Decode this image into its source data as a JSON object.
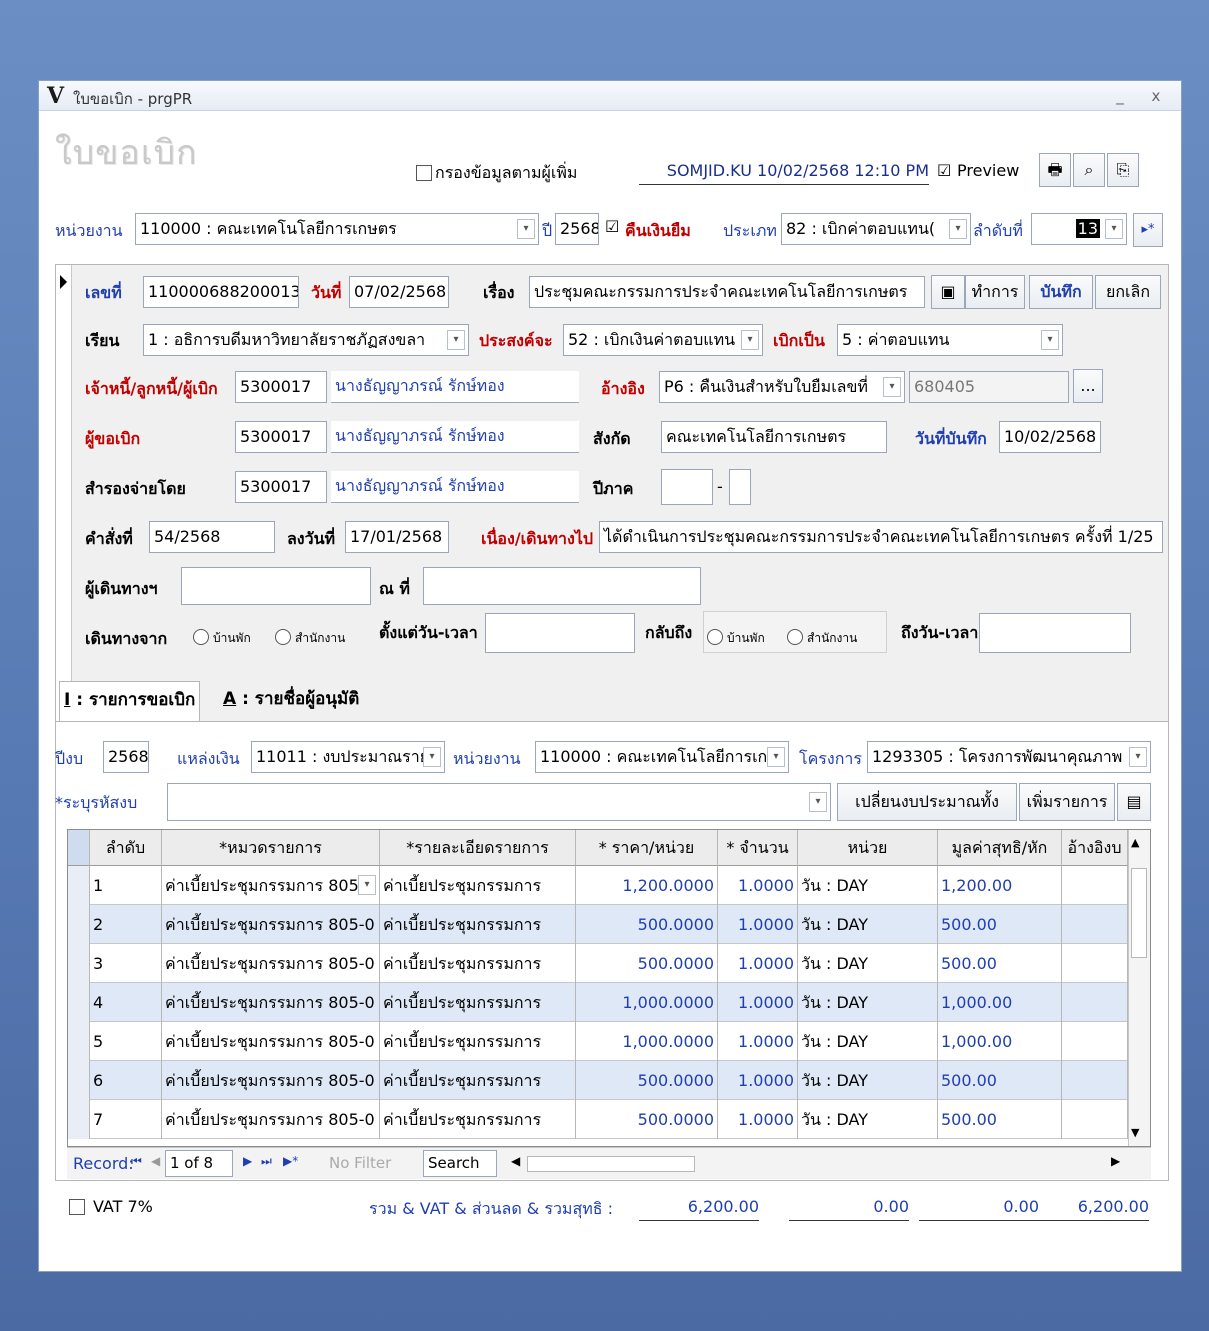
{
  "window": {
    "title": "ใบขอเบิก - prgPR",
    "logo": "V",
    "min_label": "_",
    "close_label": "x"
  },
  "header": {
    "form_title": "ใบขอเบิก",
    "filter_label": "กรองข้อมูลตามผู้เพิ่ม",
    "user_stamp": "SOMJID.KU  10/02/2568  12:10 PM",
    "preview_label": "Preview",
    "preview_checked": "☑"
  },
  "row1": {
    "unit_label": "หน่วยงาน",
    "unit_value": "110000 : คณะเทคโนโลยีการเกษตร",
    "year_label": "ปี",
    "year_value": "2568",
    "refund_label": "คืนเงินยืม",
    "refund_checked": "☑",
    "type_label": "ประเภท",
    "type_value": "82 : เบิกค่าตอบแทน(",
    "seq_label": "ลำดับที่",
    "seq_value": "13",
    "next_symbol": "▸*"
  },
  "detail": {
    "doc_no_label": "เลขที่",
    "doc_no": "110000688200013",
    "date_label": "วันที่",
    "date": "07/02/2568",
    "subject_label": "เรื่อง",
    "subject": "ประชุมคณะกรรมการประจำคณะเทคโนโลยีการเกษตร",
    "act_button": "ทำการ",
    "save_button": "บันทึก",
    "cancel_button": "ยกเลิก",
    "to_label": "เรียน",
    "to": "1 : อธิการบดีมหาวิทยาลัยราชภัฏสงขลา",
    "purpose_label": "ประสงค์จะ",
    "purpose": "52 : เบิกเงินค่าตอบแทน",
    "as_label": "เบิกเป็น",
    "as": "5 : ค่าตอบแทน",
    "creditor_label": "เจ้าหนี้/ลูกหนี้/ผู้เบิก",
    "creditor_code": "5300017",
    "creditor_name": "นางธัญญาภรณ์ รักษ์ทอง",
    "ref_label": "อ้างอิง",
    "ref_value": "P6 : คืนเงินสำหรับใบยืมเลขที่",
    "ref_no": "680405",
    "more_button": "...",
    "requester_label": "ผู้ขอเบิก",
    "requester_code": "5300017",
    "requester_name": "นางธัญญาภรณ์ รักษ์ทอง",
    "dept_label": "สังกัด",
    "dept": "คณะเทคโนโลยีการเกษตร",
    "record_date_label": "วันที่บันทึก",
    "record_date": "10/02/2568",
    "advance_label": "สำรองจ่ายโดย",
    "advance_code": "5300017",
    "advance_name": "นางธัญญาภรณ์ รักษ์ทอง",
    "term_label": "ปีภาค",
    "term_sep": "-",
    "order_label": "คำสั่งที่",
    "order_no": "54/2568",
    "order_date_label": "ลงวันที่",
    "order_date": "17/01/2568",
    "because_label": "เนื่อง/เดินทางไป",
    "because": "ได้ดำเนินการประชุมคณะกรรมการประจำคณะเทคโนโลยีการเกษตร ครั้งที่ 1/25",
    "traveler_label": "ผู้เดินทางฯ",
    "at_label": "ณ ที่",
    "from_label": "เดินทางจาก",
    "home": "บ้านพัก",
    "office": "สำนักงาน",
    "start_label": "ตั้งแต่วัน-เวลา",
    "return_label": "กลับถึง",
    "end_label": "ถึงวัน-เวลา"
  },
  "tabs": [
    {
      "key": "I",
      "label": " : รายการขอเบิก"
    },
    {
      "key": "A",
      "label": " : รายชื่อผู้อนุมัติ"
    }
  ],
  "budget": {
    "year_label": "ปีงบ",
    "year": "2568",
    "source_label": "แหล่งเงิน",
    "source": "11011 : งบประมาณราย",
    "unit_label": "หน่วยงาน",
    "unit": "110000 : คณะเทคโนโลยีการเก",
    "project_label": "โครงการ",
    "project": "1293305 : โครงการพัฒนาคุณภาพ",
    "code_label": "*ระบุรหัสงบ",
    "change_button": "เปลี่ยนงบประมาณทั้ง",
    "add_button": "เพิ่มรายการ"
  },
  "grid": {
    "columns": [
      "ลำดับ",
      "*หมวดรายการ",
      "*รายละเอียดรายการ",
      "* ราคา/หน่วย",
      "* จำนวน",
      "หน่วย",
      "มูลค่าสุทธิ/หัก",
      "อ้างอิงบ"
    ],
    "rows": [
      [
        "1",
        "ค่าเบี้ยประชุมกรรมการ 805",
        "ค่าเบี้ยประชุมกรรมการ",
        "1,200.0000",
        "1.0000",
        "วัน : DAY",
        "1,200.00",
        ""
      ],
      [
        "2",
        "ค่าเบี้ยประชุมกรรมการ 805-0",
        "ค่าเบี้ยประชุมกรรมการ",
        "500.0000",
        "1.0000",
        "วัน : DAY",
        "500.00",
        ""
      ],
      [
        "3",
        "ค่าเบี้ยประชุมกรรมการ 805-0",
        "ค่าเบี้ยประชุมกรรมการ",
        "500.0000",
        "1.0000",
        "วัน : DAY",
        "500.00",
        ""
      ],
      [
        "4",
        "ค่าเบี้ยประชุมกรรมการ 805-0",
        "ค่าเบี้ยประชุมกรรมการ",
        "1,000.0000",
        "1.0000",
        "วัน : DAY",
        "1,000.00",
        ""
      ],
      [
        "5",
        "ค่าเบี้ยประชุมกรรมการ 805-0",
        "ค่าเบี้ยประชุมกรรมการ",
        "1,000.0000",
        "1.0000",
        "วัน : DAY",
        "1,000.00",
        ""
      ],
      [
        "6",
        "ค่าเบี้ยประชุมกรรมการ 805-0",
        "ค่าเบี้ยประชุมกรรมการ",
        "500.0000",
        "1.0000",
        "วัน : DAY",
        "500.00",
        ""
      ],
      [
        "7",
        "ค่าเบี้ยประชุมกรรมการ 805-0",
        "ค่าเบี้ยประชุมกรรมการ",
        "500.0000",
        "1.0000",
        "วัน : DAY",
        "500.00",
        ""
      ]
    ]
  },
  "nav": {
    "record_label": "Record:",
    "position": "1 of 8",
    "filter": "No Filter",
    "search": "Search"
  },
  "footer": {
    "vat_label": "VAT 7%",
    "totals_label": "รวม & VAT & ส่วนลด & รวมสุทธิ :",
    "total": "6,200.00",
    "vat": "0.00",
    "discount": "0.00",
    "net": "6,200.00"
  },
  "colors": {
    "label_blue": "#1f3fb0",
    "label_red": "#c00000",
    "row_alt": "#dfe8f6"
  },
  "icons": [
    "printer-icon",
    "binoculars-icon",
    "copy-icon",
    "book-icon"
  ]
}
